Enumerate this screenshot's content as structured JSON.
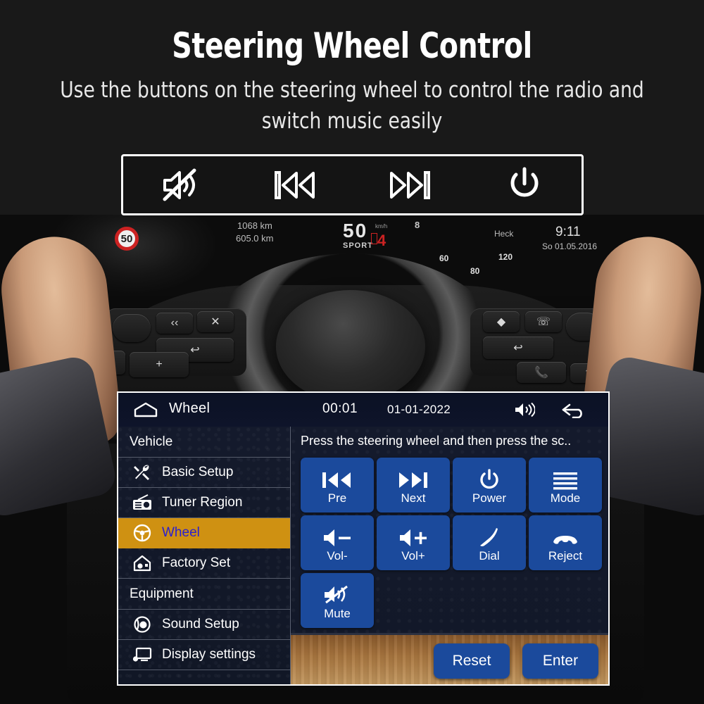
{
  "hero": {
    "title": "Steering Wheel Control",
    "subtitle": "Use the buttons on the steering wheel to control the radio and switch music easily"
  },
  "icon_strip": {
    "icons": [
      {
        "name": "mute-icon",
        "label": "Mute"
      },
      {
        "name": "previous-track-icon",
        "label": "Previous"
      },
      {
        "name": "next-track-icon",
        "label": "Next"
      },
      {
        "name": "power-icon",
        "label": "Power"
      }
    ]
  },
  "dashboard": {
    "odometer": "1068 km",
    "trip": "605.0 km",
    "speed": "50",
    "speed_unit": "km/h",
    "mode": "SPORT",
    "gear": "4",
    "gear_indicator": "8",
    "rear_label": "Heck",
    "clock": "9:11",
    "date": "So 01.05.2016",
    "speed_limit_sign": "50",
    "gauge_ticks": [
      "60",
      "80",
      "120"
    ]
  },
  "unit": {
    "header": {
      "home_icon": "home-icon",
      "title": "Wheel",
      "time": "00:01",
      "date": "01-01-2022",
      "volume_icon": "volume-icon",
      "back_icon": "back-arrow-icon"
    },
    "sidebar": {
      "groups": [
        {
          "type": "group",
          "label": "Vehicle"
        },
        {
          "type": "item",
          "label": "Basic Setup",
          "icon": "tools-icon",
          "active": false
        },
        {
          "type": "item",
          "label": "Tuner Region",
          "icon": "radio-icon",
          "active": false
        },
        {
          "type": "item",
          "label": "Wheel",
          "icon": "steering-wheel-icon",
          "active": true
        },
        {
          "type": "item",
          "label": "Factory Set",
          "icon": "factory-reset-icon",
          "active": false
        },
        {
          "type": "group",
          "label": "Equipment"
        },
        {
          "type": "item",
          "label": "Sound Setup",
          "icon": "speaker-icon",
          "active": false
        },
        {
          "type": "item",
          "label": "Display settings",
          "icon": "monitor-icon",
          "active": false
        }
      ]
    },
    "content": {
      "hint": "Press the steering wheel and then press the sc..",
      "buttons": [
        {
          "label": "Pre",
          "icon": "previous-track-icon"
        },
        {
          "label": "Next",
          "icon": "next-track-icon"
        },
        {
          "label": "Power",
          "icon": "power-icon"
        },
        {
          "label": "Mode",
          "icon": "menu-lines-icon"
        },
        {
          "label": "Vol-",
          "icon": "volume-down-icon"
        },
        {
          "label": "Vol+",
          "icon": "volume-up-icon"
        },
        {
          "label": "Dial",
          "icon": "phone-dial-icon"
        },
        {
          "label": "Reject",
          "icon": "phone-reject-icon"
        },
        {
          "label": "Mute",
          "icon": "mute-icon"
        }
      ],
      "actions": [
        {
          "label": "Reset",
          "name": "reset-button"
        },
        {
          "label": "Enter",
          "name": "enter-button"
        }
      ]
    }
  },
  "colors": {
    "button_blue": "#1b4a9c",
    "highlight_amber": "#cf9112",
    "active_label_blue": "#2a1fd0",
    "screen_navy": "#141a2c"
  }
}
